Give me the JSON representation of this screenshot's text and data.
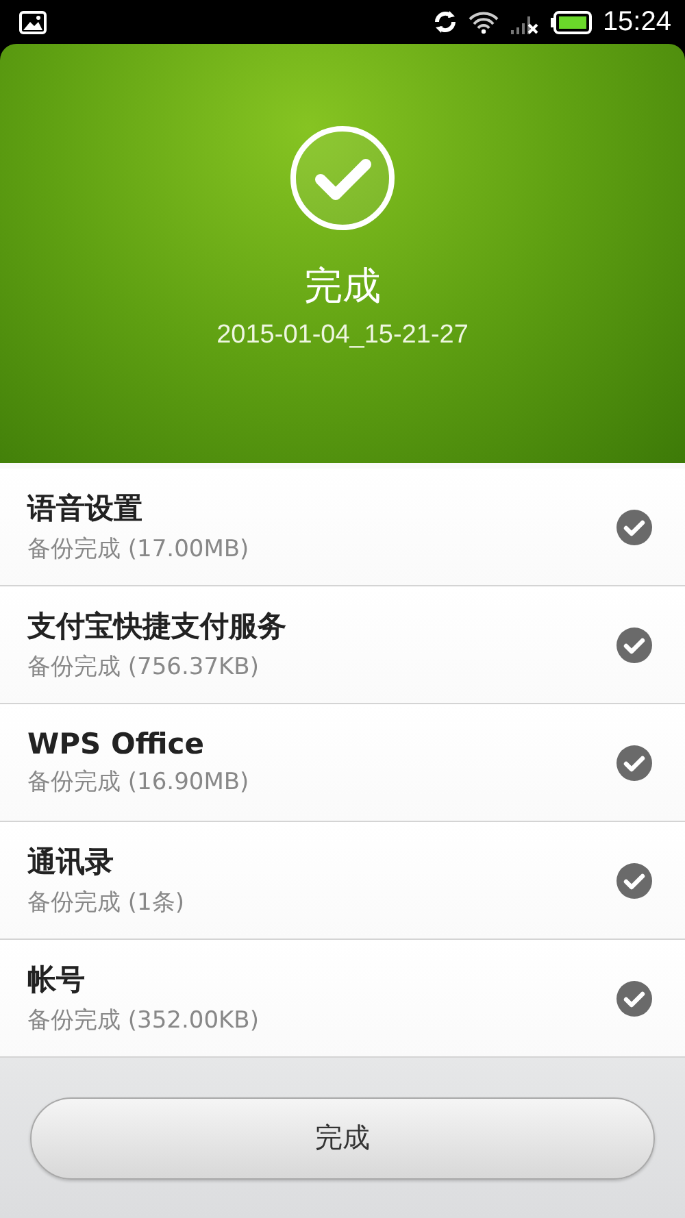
{
  "status_bar": {
    "time": "15:24"
  },
  "header": {
    "title": "完成",
    "timestamp": "2015-01-04_15-21-27"
  },
  "items": [
    {
      "name": "语音设置",
      "detail": "备份完成 (17.00MB)"
    },
    {
      "name": "支付宝快捷支付服务",
      "detail": "备份完成 (756.37KB)"
    },
    {
      "name": "WPS Office",
      "detail": "备份完成 (16.90MB)"
    },
    {
      "name": "通讯录",
      "detail": "备份完成 (1条)"
    },
    {
      "name": "帐号",
      "detail": "备份完成 (352.00KB)"
    }
  ],
  "button": {
    "label": "完成"
  }
}
